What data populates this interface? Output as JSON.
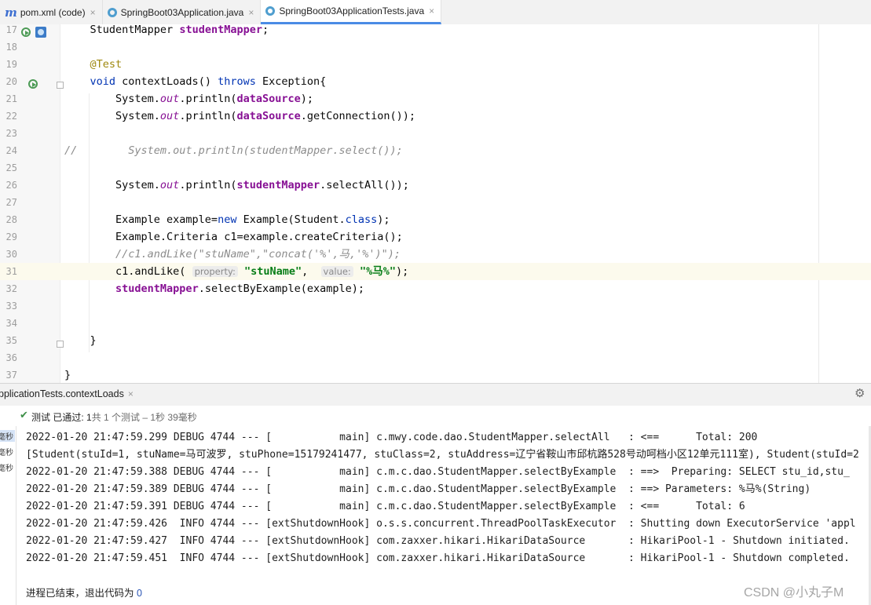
{
  "tabs": [
    {
      "icon": "maven-m-icon",
      "label": "pom.xml (code)",
      "active": false
    },
    {
      "icon": "java-class-icon",
      "label": "SpringBoot03Application.java",
      "active": false
    },
    {
      "icon": "java-class-icon",
      "label": "SpringBoot03ApplicationTests.java",
      "active": true
    }
  ],
  "tab_icon_text": "m",
  "tab_close_glyph": "×",
  "editor": {
    "current_line": "31",
    "lines": [
      {
        "n": "17",
        "tokens": [
          [
            "",
            "    "
          ],
          [
            "",
            "StudentMapper "
          ],
          [
            "fld",
            "studentMapper"
          ],
          [
            "",
            ";"
          ]
        ]
      },
      {
        "n": "18",
        "tokens": []
      },
      {
        "n": "19",
        "tokens": [
          [
            "",
            "    "
          ],
          [
            "ann",
            "@Test"
          ]
        ]
      },
      {
        "n": "20",
        "tokens": [
          [
            "",
            "    "
          ],
          [
            "kw",
            "void "
          ],
          [
            "",
            "contextLoads() "
          ],
          [
            "kw",
            "throws "
          ],
          [
            "",
            "Exception{"
          ]
        ]
      },
      {
        "n": "21",
        "tokens": [
          [
            "",
            "        System."
          ],
          [
            "st",
            "out"
          ],
          [
            "",
            ".println("
          ],
          [
            "fld",
            "dataSource"
          ],
          [
            "",
            ");"
          ]
        ]
      },
      {
        "n": "22",
        "tokens": [
          [
            "",
            "        System."
          ],
          [
            "st",
            "out"
          ],
          [
            "",
            ".println("
          ],
          [
            "fld",
            "dataSource"
          ],
          [
            "",
            ".getConnection());"
          ]
        ]
      },
      {
        "n": "23",
        "tokens": []
      },
      {
        "n": "24",
        "tokens": [
          [
            "cmt",
            "//        System.out.println(studentMapper.select());"
          ]
        ]
      },
      {
        "n": "25",
        "tokens": []
      },
      {
        "n": "26",
        "tokens": [
          [
            "",
            "        System."
          ],
          [
            "st",
            "out"
          ],
          [
            "",
            ".println("
          ],
          [
            "fld",
            "studentMapper"
          ],
          [
            "",
            ".selectAll());"
          ]
        ]
      },
      {
        "n": "27",
        "tokens": []
      },
      {
        "n": "28",
        "tokens": [
          [
            "",
            "        Example example="
          ],
          [
            "kw",
            "new "
          ],
          [
            "",
            "Example(Student."
          ],
          [
            "kw",
            "class"
          ],
          [
            "",
            ");"
          ]
        ]
      },
      {
        "n": "29",
        "tokens": [
          [
            "",
            "        Example.Criteria c1=example.createCriteria();"
          ]
        ]
      },
      {
        "n": "30",
        "tokens": [
          [
            "cmt",
            "        //c1.andLike(\"stuName\",\"concat('%',马,'%')\");"
          ]
        ]
      },
      {
        "n": "31",
        "tokens": [
          [
            "",
            "        c1.andLike( "
          ],
          [
            "hint",
            "property:"
          ],
          [
            "",
            ""
          ],
          [
            "str",
            " \"stuName\""
          ],
          [
            "",
            ",  "
          ],
          [
            "hint",
            "value:"
          ],
          [
            "str",
            " \"%马%\""
          ],
          [
            "",
            ");"
          ]
        ]
      },
      {
        "n": "32",
        "tokens": [
          [
            "",
            "        "
          ],
          [
            "fld",
            "studentMapper"
          ],
          [
            "",
            ".selectByExample(example);"
          ]
        ]
      },
      {
        "n": "33",
        "tokens": []
      },
      {
        "n": "34",
        "tokens": []
      },
      {
        "n": "35",
        "tokens": [
          [
            "",
            "    }"
          ]
        ]
      },
      {
        "n": "36",
        "tokens": []
      },
      {
        "n": "37",
        "tokens": [
          [
            "",
            "}"
          ]
        ]
      }
    ]
  },
  "run_panel": {
    "tab_label": "pplicationTests.contextLoads",
    "close_glyph": "×",
    "settings_glyph": "⚙",
    "check_glyph": "✔",
    "status_bold": "测试 已通过: ",
    "status_count": "1",
    "status_rest": "共 1 个测试 – 1秒 39毫秒",
    "tree_items": [
      "毫秒",
      "毫秒",
      "毫秒"
    ]
  },
  "console": {
    "lines": [
      "2022-01-20 21:47:59.299 DEBUG 4744 --- [           main] c.mwy.code.dao.StudentMapper.selectAll   : <==      Total: 200",
      "[Student(stuId=1, stuName=马可波罗, stuPhone=15179241477, stuClass=2, stuAddress=辽宁省鞍山市邱杭路528号动呵档小区12单元111室), Student(stuId=2",
      "2022-01-20 21:47:59.388 DEBUG 4744 --- [           main] c.m.c.dao.StudentMapper.selectByExample  : ==>  Preparing: SELECT stu_id,stu_",
      "2022-01-20 21:47:59.389 DEBUG 4744 --- [           main] c.m.c.dao.StudentMapper.selectByExample  : ==> Parameters: %马%(String)",
      "2022-01-20 21:47:59.391 DEBUG 4744 --- [           main] c.m.c.dao.StudentMapper.selectByExample  : <==      Total: 6",
      "2022-01-20 21:47:59.426  INFO 4744 --- [extShutdownHook] o.s.s.concurrent.ThreadPoolTaskExecutor  : Shutting down ExecutorService 'appl",
      "2022-01-20 21:47:59.427  INFO 4744 --- [extShutdownHook] com.zaxxer.hikari.HikariDataSource       : HikariPool-1 - Shutdown initiated.",
      "2022-01-20 21:47:59.451  INFO 4744 --- [extShutdownHook] com.zaxxer.hikari.HikariDataSource       : HikariPool-1 - Shutdown completed."
    ],
    "exit_message": "进程已结束，退出代码为 ",
    "exit_code": "0"
  },
  "watermark": "CSDN @小丸子M",
  "colors": {
    "accent": "#4a8be5",
    "pass_green": "#3d8f48",
    "keyword": "#0033b3",
    "field": "#871094",
    "string": "#067d17",
    "annotation": "#9e880d",
    "comment": "#8c8c8c"
  }
}
